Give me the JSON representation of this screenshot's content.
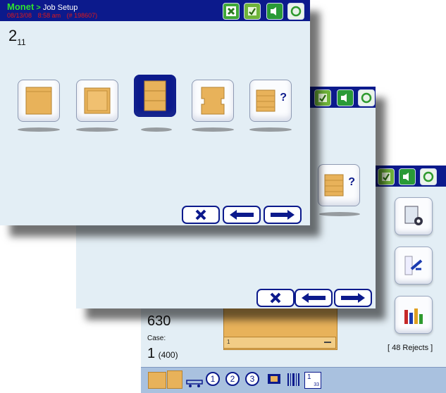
{
  "app": {
    "brand": "Monet",
    "breadcrumb_sep": ">",
    "screen_title": "Job Setup",
    "date": "08/13/08",
    "time": "8:58 am",
    "job_ref": "(# 198607)"
  },
  "front_dialog": {
    "page_num": "2",
    "page_den": "11",
    "pallet_options": [
      {
        "icon": "pallet-plain-icon",
        "selected": false
      },
      {
        "icon": "pallet-framed-icon",
        "selected": false
      },
      {
        "icon": "pallet-slats-icon",
        "selected": true
      },
      {
        "icon": "pallet-notched-icon",
        "selected": false
      },
      {
        "icon": "pallet-unknown-icon",
        "mark": "?",
        "selected": false
      }
    ]
  },
  "back_panel": {
    "count_value": "630",
    "case_label": "Case:",
    "case_value": "1",
    "case_total": "(400)",
    "rejects": "[ 48 Rejects ]",
    "marker_left": "1",
    "unknown_mark": "?"
  },
  "bottom_bar": {
    "num_1": "1",
    "num_2": "2",
    "num_3": "3",
    "fraction_top": "1",
    "fraction_bottom": "33"
  },
  "colors": {
    "titlebar": "#0c1a8c",
    "brand": "#2fe02f",
    "status_red": "#e01818",
    "wood": "#e8b25a"
  }
}
